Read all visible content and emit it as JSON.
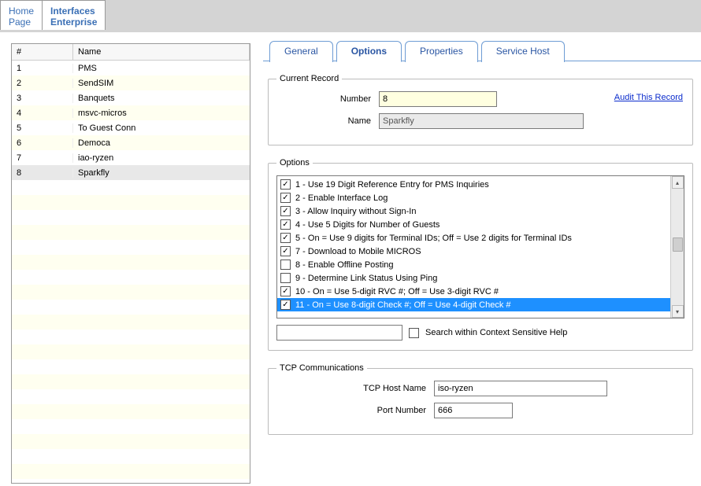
{
  "topbar": {
    "tabs": [
      {
        "line1": "Home",
        "line2": "Page"
      },
      {
        "line1": "Interfaces",
        "line2": "Enterprise"
      }
    ],
    "active_index": 1
  },
  "grid": {
    "headers": {
      "num": "#",
      "name": "Name"
    },
    "rows": [
      {
        "num": "1",
        "name": "PMS"
      },
      {
        "num": "2",
        "name": "SendSIM"
      },
      {
        "num": "3",
        "name": "Banquets"
      },
      {
        "num": "4",
        "name": "msvc-micros"
      },
      {
        "num": "5",
        "name": "To Guest Conn"
      },
      {
        "num": "6",
        "name": "Democa"
      },
      {
        "num": "7",
        "name": "iao-ryzen"
      },
      {
        "num": "8",
        "name": "Sparkfly"
      }
    ]
  },
  "detail": {
    "tabs": [
      "General",
      "Options",
      "Properties",
      "Service Host"
    ],
    "active_index": 1,
    "current_record": {
      "legend": "Current Record",
      "number_label": "Number",
      "number_value": "8",
      "name_label": "Name",
      "name_value": "Sparkfly",
      "audit_link": "Audit This Record"
    },
    "options_group": {
      "legend": "Options",
      "items": [
        {
          "checked": true,
          "label": "1 - Use 19 Digit Reference Entry for PMS Inquiries"
        },
        {
          "checked": true,
          "label": "2 - Enable Interface Log"
        },
        {
          "checked": true,
          "label": "3 - Allow Inquiry without Sign-In"
        },
        {
          "checked": true,
          "label": "4 - Use 5 Digits for Number of Guests"
        },
        {
          "checked": true,
          "label": "5 - On = Use 9 digits for Terminal IDs; Off = Use 2 digits for Terminal IDs"
        },
        {
          "checked": true,
          "label": "7 - Download to Mobile MICROS"
        },
        {
          "checked": false,
          "label": "8 - Enable Offline Posting"
        },
        {
          "checked": false,
          "label": "9 - Determine Link Status Using Ping"
        },
        {
          "checked": true,
          "label": "10 - On = Use 5-digit RVC #; Off = Use 3-digit RVC #"
        },
        {
          "checked": true,
          "label": "11 - On = Use 8-digit Check #; Off = Use 4-digit Check #",
          "selected": true
        }
      ],
      "search_label": "Search within Context Sensitive Help"
    },
    "tcp": {
      "legend": "TCP Communications",
      "host_label": "TCP Host Name",
      "host_value": "iso-ryzen",
      "port_label": "Port Number",
      "port_value": "666"
    }
  }
}
